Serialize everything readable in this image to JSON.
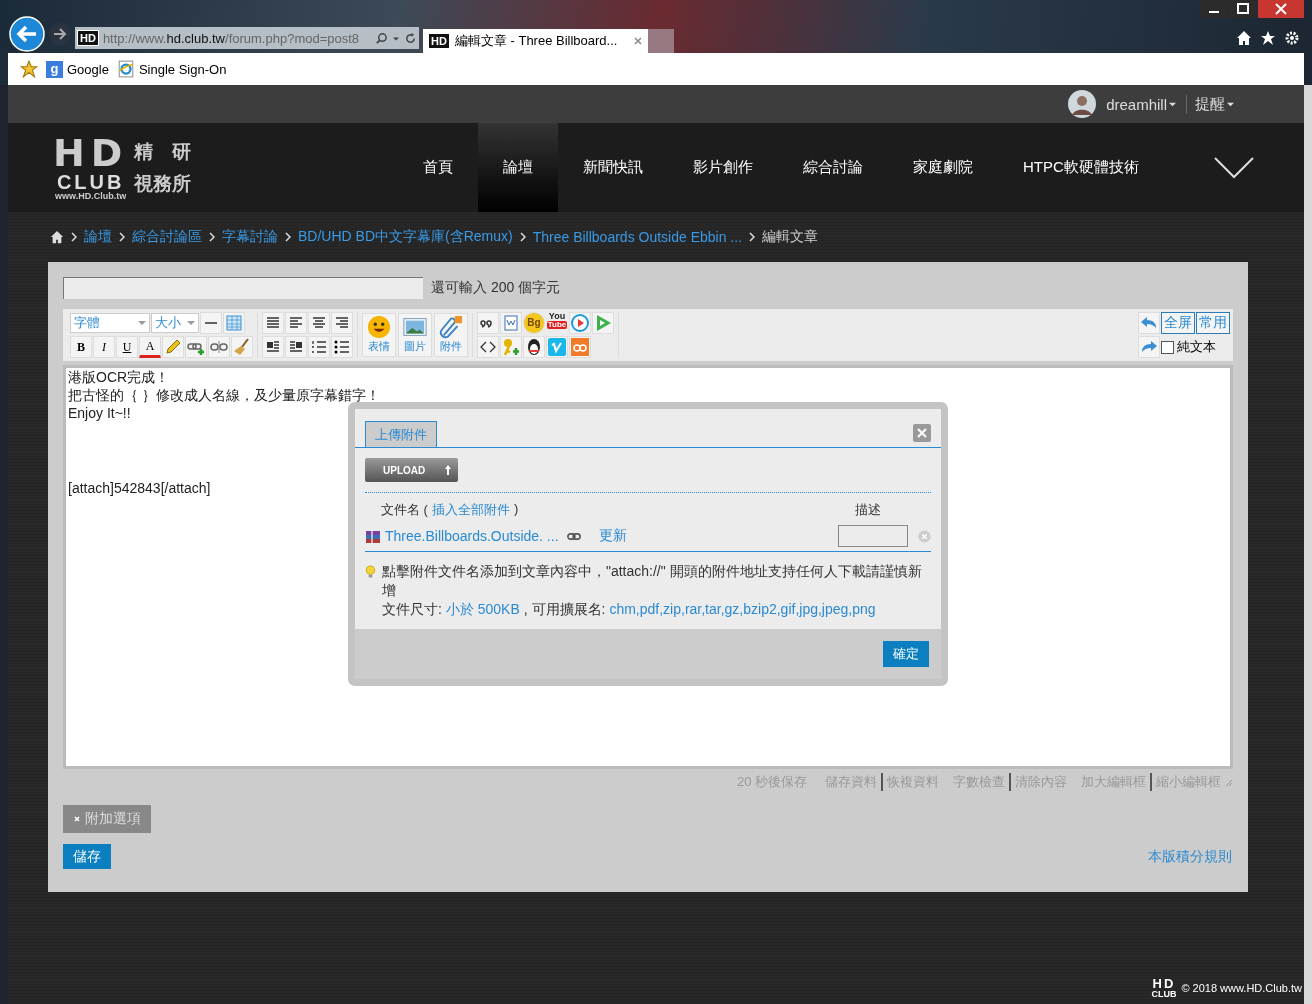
{
  "browser": {
    "address": {
      "favicon": "HD",
      "scheme": "http://www.",
      "domain": "hd.club.tw",
      "path": "/forum.php?mod=post8"
    },
    "tab": {
      "favicon": "HD",
      "title": "編輯文章 - Three Billboard..."
    },
    "favorites": [
      {
        "kind": "google",
        "icon_letter": "g",
        "label": "Google"
      },
      {
        "kind": "ie",
        "label": "Single Sign-On"
      }
    ]
  },
  "user_bar": {
    "name": "dreamhill",
    "alerts": "提醒"
  },
  "logo": {
    "big": "HD",
    "club": "CLUB",
    "url": "www.HD.Club.tw",
    "tag_top": "精　研",
    "tag_bottom": "視務所"
  },
  "nav": [
    {
      "label": "首頁",
      "selected": false
    },
    {
      "label": "論壇",
      "selected": true
    },
    {
      "label": "新聞快訊",
      "selected": false
    },
    {
      "label": "影片創作",
      "selected": false
    },
    {
      "label": "綜合討論",
      "selected": false
    },
    {
      "label": "家庭劇院",
      "selected": false
    },
    {
      "label": "HTPC軟硬體技術",
      "selected": false
    }
  ],
  "breadcrumb": [
    {
      "label": "論壇",
      "kind": "link"
    },
    {
      "label": "綜合討論區",
      "kind": "link"
    },
    {
      "label": "字幕討論",
      "kind": "link"
    },
    {
      "label": "BD/UHD BD中文字幕庫(含Remux)",
      "kind": "link"
    },
    {
      "label": "Three Billboards Outside Ebbin ...",
      "kind": "link"
    },
    {
      "label": "編輯文章",
      "kind": "current"
    }
  ],
  "subject": {
    "counter": "還可輸入 200 個字元"
  },
  "toolbar": {
    "font": "字體",
    "size": "大小",
    "format_keys": [
      "B",
      "I",
      "U",
      "A"
    ],
    "insert_buttons": [
      {
        "label": "表情",
        "kind": "emoji"
      },
      {
        "label": "圖片",
        "kind": "image"
      },
      {
        "label": "附件",
        "kind": "attach"
      }
    ],
    "bg_badge": "Bg",
    "youtube_top": "You",
    "youtube_bottom": "Tube",
    "fullscreen": "全屏",
    "common": "常用",
    "plain_text": {
      "label": "純文本",
      "checked": false
    }
  },
  "editor": {
    "paragraphs": [
      [
        "港版OCR完成！",
        "把古怪的｛ ｝修改成人名線，及少量原字幕錯字！",
        "Enjoy It~!!"
      ],
      [
        "[attach]542843[/attach]"
      ]
    ]
  },
  "dialog": {
    "tab": "上傳附件",
    "upload": "UPLOAD",
    "file_header": {
      "prefix": "文件名 (",
      "link": "插入全部附件",
      "suffix": ")"
    },
    "description_header": "描述",
    "file": {
      "name": "Three.Billboards.Outside. ...",
      "update": "更新"
    },
    "tip": "點擊附件文件名添加到文章內容中，\"attach://\" 開頭的附件地址支持任何人下載請謹慎新增",
    "size": {
      "label": "文件尺寸:",
      "limit": "小於 500KB",
      "ext_label": ", 可用擴展名:",
      "extensions": "chm,pdf,zip,rar,tar,gz,bzip2,gif,jpg,jpeg,png"
    },
    "confirm": "確定"
  },
  "editor_footer": {
    "autosave": "20 秒後保存",
    "link_groups": [
      [
        "儲存資料",
        "恢複資料"
      ],
      [
        "字數檢查",
        "清除內容"
      ],
      [
        "加大編輯框",
        "縮小編輯框"
      ]
    ]
  },
  "extra_options": "附加選項",
  "save": "儲存",
  "rules": "本版積分規則",
  "footer": {
    "logo": "HD",
    "logo_sub": "CLUB",
    "copyright": "© 2018 www.HD.Club.tw"
  }
}
